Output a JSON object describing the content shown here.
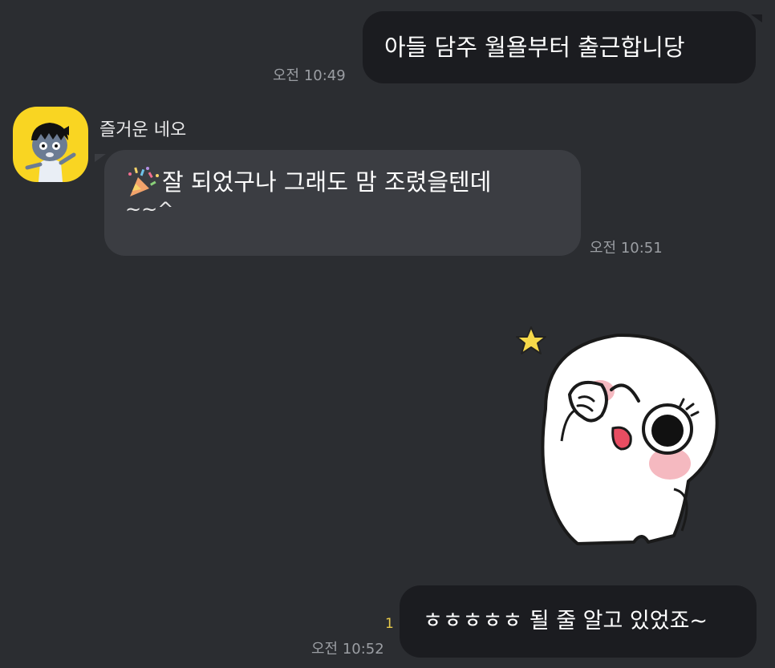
{
  "messages": [
    {
      "id": "m1",
      "direction": "outgoing",
      "text": "아들 담주 월욜부터 출근합니당",
      "time": "오전 10:49"
    },
    {
      "id": "m2",
      "direction": "incoming",
      "sender": "즐거운 네오",
      "line1": "잘 되었구나 그래도 맘 조렸을텐데",
      "line2": "~~^",
      "emoji": "party-popper",
      "time": "오전 10:51"
    },
    {
      "id": "m3",
      "direction": "incoming",
      "type": "sticker",
      "sticker": "white-blob-salute-sticker"
    },
    {
      "id": "m4",
      "direction": "outgoing",
      "text": "ㅎㅎㅎㅎㅎ 될 줄 알고 있었죠~",
      "time": "오전 10:52",
      "unread": "1"
    }
  ],
  "colors": {
    "background": "#2b2d31",
    "outgoing_bubble": "#1b1c20",
    "incoming_bubble": "#3b3d42",
    "avatar_bg": "#f9d522",
    "timestamp": "#9b9ea3",
    "unread": "#e6c94a"
  }
}
